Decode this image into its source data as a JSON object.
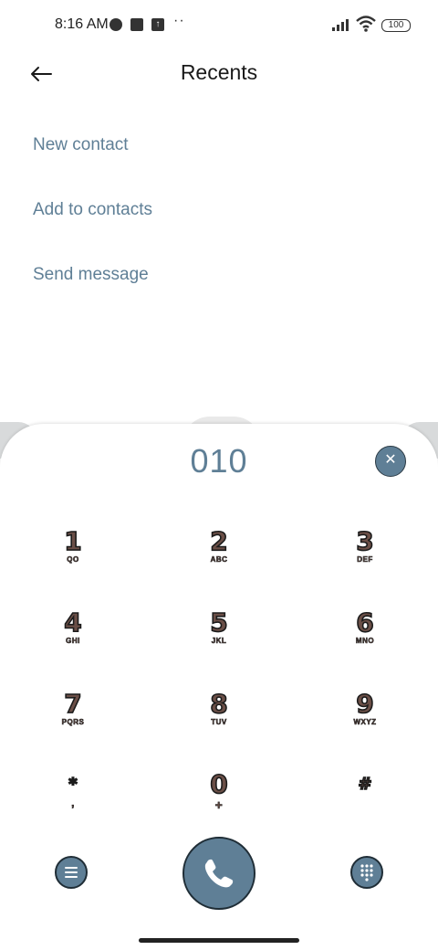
{
  "status_bar": {
    "time": "8:16 AM",
    "dots": "··",
    "battery": "100"
  },
  "header": {
    "title": "Recents",
    "back_icon": "arrow-left-icon"
  },
  "actions": [
    {
      "label": "New contact"
    },
    {
      "label": "Add to contacts"
    },
    {
      "label": "Send message"
    }
  ],
  "dialpad": {
    "number": "010",
    "clear_icon": "close-icon",
    "keys": [
      {
        "digit": "1",
        "letters": "QO"
      },
      {
        "digit": "2",
        "letters": "ABC"
      },
      {
        "digit": "3",
        "letters": "DEF"
      },
      {
        "digit": "4",
        "letters": "GHI"
      },
      {
        "digit": "5",
        "letters": "JKL"
      },
      {
        "digit": "6",
        "letters": "MNO"
      },
      {
        "digit": "7",
        "letters": "PQRS"
      },
      {
        "digit": "8",
        "letters": "TUV"
      },
      {
        "digit": "9",
        "letters": "WXYZ"
      },
      {
        "digit": "*",
        "letters": ","
      },
      {
        "digit": "0",
        "letters": "+"
      },
      {
        "digit": "#",
        "letters": ""
      }
    ],
    "menu_icon": "menu-icon",
    "call_icon": "phone-icon",
    "dialpad_icon": "dialpad-grid-icon"
  },
  "colors": {
    "accent": "#5f7f96",
    "key_fill": "#6b4f47"
  }
}
